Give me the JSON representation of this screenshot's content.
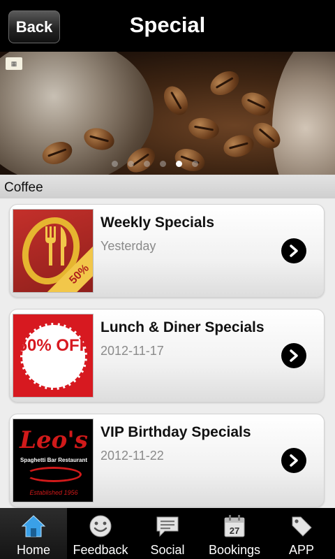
{
  "header": {
    "back_label": "Back",
    "title": "Special"
  },
  "banner": {
    "image": "coffee-beans-grinder-photo",
    "badge_icon": "qr-code-icon",
    "pages": 6,
    "active_page": 4
  },
  "section": {
    "title": "Coffee"
  },
  "specials": [
    {
      "title": "Weekly Specials",
      "date": "Yesterday",
      "thumb_text": "50%"
    },
    {
      "title": "Lunch & Diner Specials",
      "date": "2012-11-17",
      "thumb_text": "50% OFF"
    },
    {
      "title": "VIP Birthday Specials",
      "date": "2012-11-22",
      "thumb_text": "Leo's",
      "thumb_subtext": "Spaghetti Bar Restaurant",
      "thumb_est": "Established 1956"
    }
  ],
  "tabs": [
    {
      "label": "Home",
      "icon": "home-icon"
    },
    {
      "label": "Feedback",
      "icon": "smiley-icon"
    },
    {
      "label": "Social",
      "icon": "chat-bubble-icon"
    },
    {
      "label": "Bookings",
      "icon": "calendar-icon",
      "icon_text": "27"
    },
    {
      "label": "APP",
      "icon": "tag-icon"
    }
  ],
  "colors": {
    "header_bg": "#000000",
    "tab_icon_blue": "#3aa0e8",
    "arrow_bg": "#000000",
    "date_text": "#8a8a8a"
  }
}
